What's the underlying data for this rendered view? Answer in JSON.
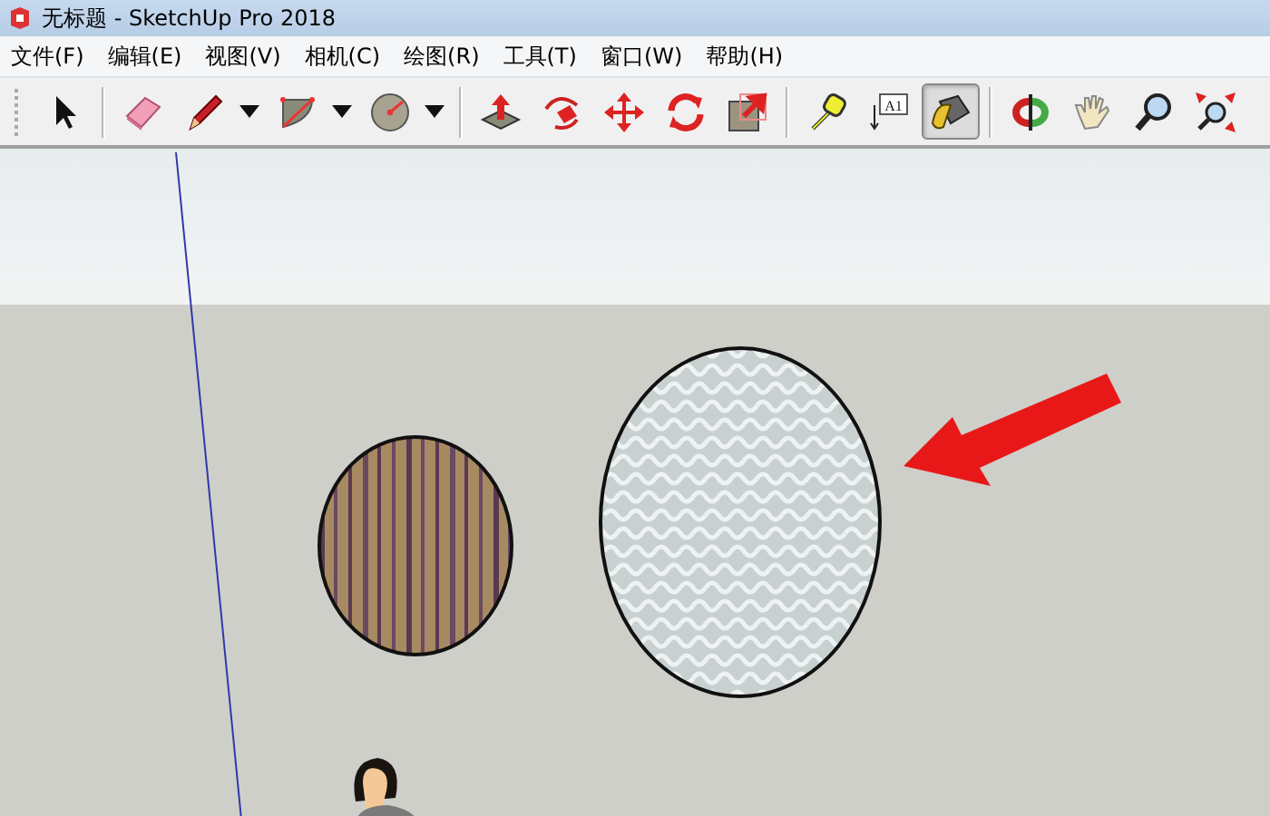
{
  "window": {
    "title": "无标题 - SketchUp Pro 2018"
  },
  "menu": [
    "文件(F)",
    "编辑(E)",
    "视图(V)",
    "相机(C)",
    "绘图(R)",
    "工具(T)",
    "窗口(W)",
    "帮助(H)"
  ],
  "toolbar": [
    [
      {
        "kind": "select",
        "selected": false,
        "dropdown": false
      }
    ],
    [
      {
        "kind": "eraser",
        "selected": false,
        "dropdown": false
      },
      {
        "kind": "pencil",
        "selected": false,
        "dropdown": true
      },
      {
        "kind": "arc",
        "selected": false,
        "dropdown": true
      },
      {
        "kind": "circle",
        "selected": false,
        "dropdown": true
      }
    ],
    [
      {
        "kind": "pushpull",
        "selected": false,
        "dropdown": false
      },
      {
        "kind": "followme",
        "selected": false,
        "dropdown": false
      },
      {
        "kind": "move",
        "selected": false,
        "dropdown": false
      },
      {
        "kind": "rotate",
        "selected": false,
        "dropdown": false
      },
      {
        "kind": "scale",
        "selected": false,
        "dropdown": false
      }
    ],
    [
      {
        "kind": "tape",
        "selected": false,
        "dropdown": false
      },
      {
        "kind": "text",
        "label": "A1",
        "selected": false,
        "dropdown": false
      },
      {
        "kind": "paint",
        "selected": true,
        "dropdown": false
      }
    ],
    [
      {
        "kind": "orbit",
        "selected": false,
        "dropdown": false
      },
      {
        "kind": "pan",
        "selected": false,
        "dropdown": false
      },
      {
        "kind": "zoom",
        "selected": false,
        "dropdown": false
      },
      {
        "kind": "zoomextents",
        "selected": false,
        "dropdown": false
      }
    ]
  ]
}
